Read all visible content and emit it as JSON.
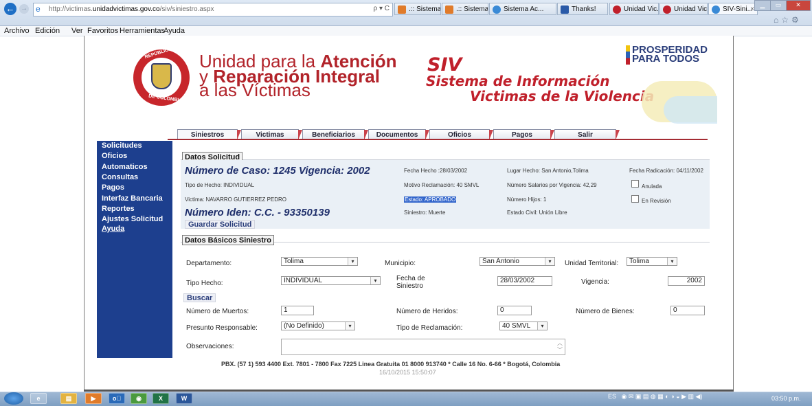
{
  "browser": {
    "address": {
      "pre": "http://victimas.",
      "domain": "unidadvictimas.gov.co",
      "post": "/siv/siniestro.aspx"
    },
    "address_tools": "ρ ▾ C",
    "tabs": [
      {
        "label": ".:: Sistema ...",
        "color": "#e07b2a"
      },
      {
        "label": ".:: Sistema ...",
        "color": "#e07b2a"
      },
      {
        "label": "Sistema Ac...",
        "color": "#3a8ad6"
      },
      {
        "label": "Thanks!",
        "color": "#2a5aa8"
      },
      {
        "label": "Unidad Vic...",
        "color": "#c0202b"
      },
      {
        "label": "Unidad Vic...",
        "color": "#c0202b"
      },
      {
        "label": "SIV-Sini...",
        "color": "#3a8ad6"
      }
    ],
    "tab_close": "×",
    "menu": [
      "Archivo",
      "Edición",
      "Ver",
      "Favoritos",
      "Herramientas",
      "Ayuda"
    ]
  },
  "header": {
    "seal_top": "REPÚBLICA",
    "seal_bottom": "DE COLOMBIA",
    "brand_line1_a": "Unidad para la ",
    "brand_line1_b": "Atención",
    "brand_line2_a": "y ",
    "brand_line2_b": "Reparación Integral",
    "brand_line3": "a las Víctimas",
    "siv": "SIV",
    "siv_sub1": "Sistema de Información",
    "siv_sub2": "Victimas de la Violencia",
    "prosperidad_1": "PROSPERIDAD",
    "prosperidad_2": "PARA TODOS"
  },
  "nav_tabs": [
    "Siniestros",
    "Victimas",
    "Beneficiarios",
    "Documentos",
    "Oficios",
    "Pagos",
    "Salir"
  ],
  "sidebar": [
    "Solicitudes",
    "Oficios",
    "Automaticos",
    "Consultas",
    "Pagos",
    "Interfaz Bancaria",
    "Reportes",
    "Ajustes Solicitud",
    "Ayuda"
  ],
  "solicitud": {
    "section_title": "Datos Solicitud",
    "caso": "Número de Caso: 1245 Vigencia: 2002",
    "fecha_hecho": "Fecha Hecho :28/03/2002",
    "lugar_hecho": "Lugar Hecho: San Antonio,Tolima",
    "fecha_radicacion": "Fecha Radicación: 04/11/2002",
    "tipo_hecho": "Tipo de Hecho: INDIVIDUAL",
    "motivo": "Motivo Reclamación: 40 SMVL",
    "salarios": "Número Salarios por Vigencia: 42,29",
    "anulada": "Anulada",
    "victima": "Victima: NAVARRO GUTIERREZ PEDRO",
    "estado": "Estado: APROBADO",
    "hijos": "Número Hijos: 1",
    "en_revision": "En Revisión",
    "iden": "Número Iden: C.C. - 93350139",
    "siniestro": "Siniestro: Muerte",
    "estado_civil": "Estado Civil: Unión Libre",
    "guardar": "Guardar Solicitud"
  },
  "siniestro": {
    "section_title": "Datos Básicos Siniestro",
    "departamento_label": "Departamento:",
    "departamento": "Tolima",
    "municipio_label": "Municipio:",
    "municipio": "San Antonio",
    "unidad_label": "Unidad Territorial:",
    "unidad": "Tolima",
    "tipo_hecho_label": "Tipo Hecho:",
    "tipo_hecho": "INDIVIDUAL",
    "fecha_label_1": "Fecha de",
    "fecha_label_2": "Siniestro",
    "fecha": "28/03/2002",
    "vigencia_label": "Vigencia:",
    "vigencia": "2002",
    "buscar": "Buscar",
    "muertos_label": "Número de Muertos:",
    "muertos": "1",
    "heridos_label": "Número de Heridos:",
    "heridos": "0",
    "bienes_label": "Número de Bienes:",
    "bienes": "0",
    "responsable_label": "Presunto Responsable:",
    "responsable": "(No Definido)",
    "reclamacion_label": "Tipo de Reclamación:",
    "reclamacion": "40 SMVL",
    "observaciones_label": "Observaciones:"
  },
  "footer": {
    "contact": "PBX. (57 1) 593 4400 Ext. 7801 - 7800 Fax 7225 Linea Gratuita 01 8000 913740 * Calle 16 No. 6-66 * Bogotá, Colombia",
    "datetime": "16/10/2015 15:50:07"
  },
  "taskbar": {
    "buttons": [
      "e",
      "▤",
      "▶",
      "o⃞",
      "◉",
      "X",
      "W"
    ],
    "tray_lang": "ES",
    "clock": "03:50 p.m."
  }
}
